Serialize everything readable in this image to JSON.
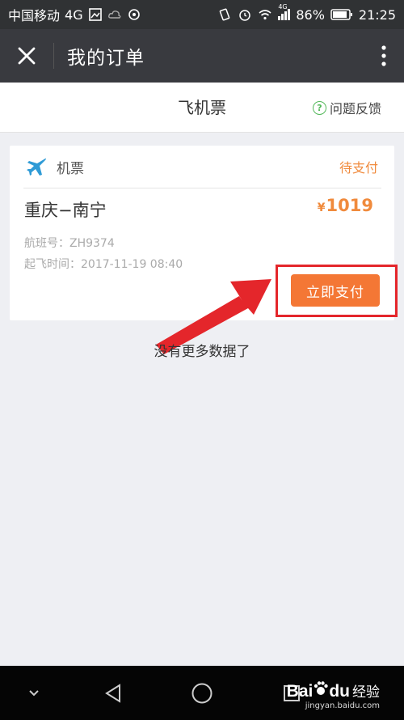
{
  "status_bar": {
    "carrier": "中国移动",
    "network": "4G",
    "signal_badge": "4G",
    "battery": "86%",
    "time": "21:25"
  },
  "title_bar": {
    "title": "我的订单",
    "close_icon": "close-icon",
    "more_icon": "more-vertical-icon"
  },
  "sub_header": {
    "title": "飞机票",
    "feedback_label": "问题反馈",
    "feedback_icon": "question-circle-icon",
    "feedback_icon_color": "#53b85a"
  },
  "order": {
    "type_label": "机票",
    "type_icon": "airplane-icon",
    "type_icon_color": "#2f9bd6",
    "status": "待支付",
    "route": "重庆−南宁",
    "price_symbol": "¥",
    "price": "1019",
    "flight_no_label": "航班号：",
    "flight_no": "ZH9374",
    "depart_label": "起飞时间：",
    "depart_time": "2017-11-19 08:40",
    "pay_button": "立即支付",
    "accent_color": "#f47735"
  },
  "list_footer": "没有更多数据了",
  "nav_bar": {
    "watermark_brand_a": "Bai",
    "watermark_brand_b": "du",
    "watermark_suffix": "经验",
    "watermark_url": "jingyan.baidu.com"
  }
}
